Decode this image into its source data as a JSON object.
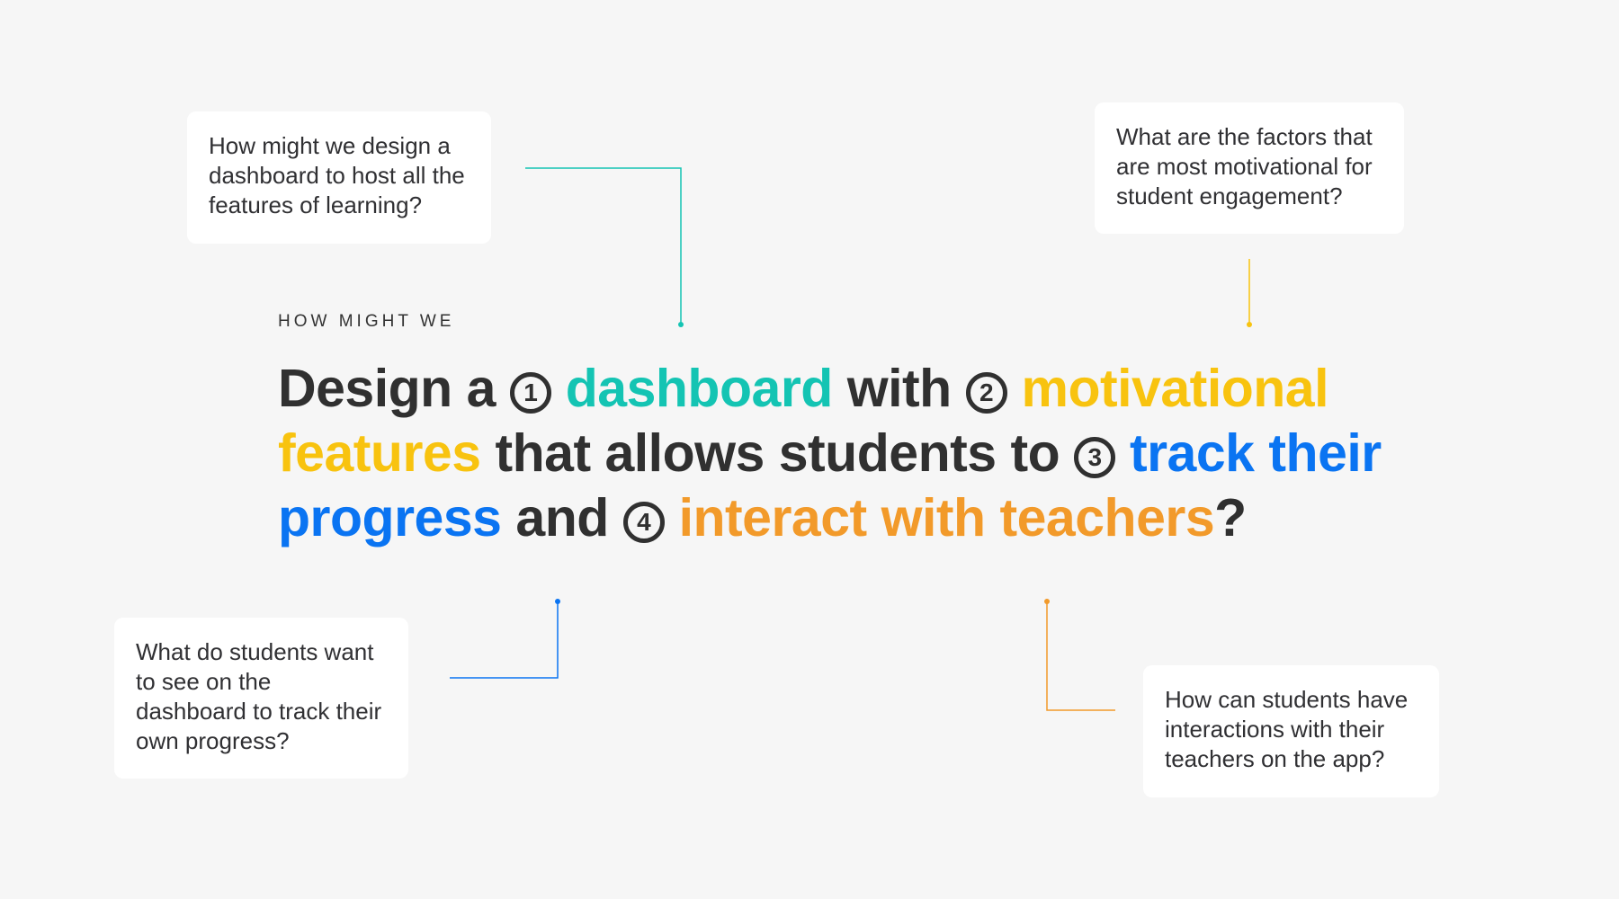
{
  "cards": {
    "dashboard_question": "How might we design a dashboard to host all the features of learning?",
    "motivation_question": "What are the factors that are most motivational for student engagement?",
    "progress_question": "What do students want to see on the dashboard to track their own progress?",
    "interaction_question": "How can students have interactions with their teachers on the app?"
  },
  "statement": {
    "eyebrow": "HOW MIGHT WE",
    "part_1": "Design a ",
    "num_1": "1",
    "highlight_1": "dashboard",
    "part_2": " with ",
    "num_2": "2",
    "highlight_2": "motivational features",
    "part_3": " that allows students to ",
    "num_3": "3",
    "highlight_3": "track their progress",
    "part_4": " and ",
    "num_4": "4",
    "highlight_4": "interact with teachers",
    "part_5": "?"
  },
  "colors": {
    "teal": "#14c4b3",
    "yellow": "#f8c30f",
    "blue": "#0a74f2",
    "orange": "#f29a2a",
    "text": "#303030",
    "background": "#f6f6f6"
  }
}
